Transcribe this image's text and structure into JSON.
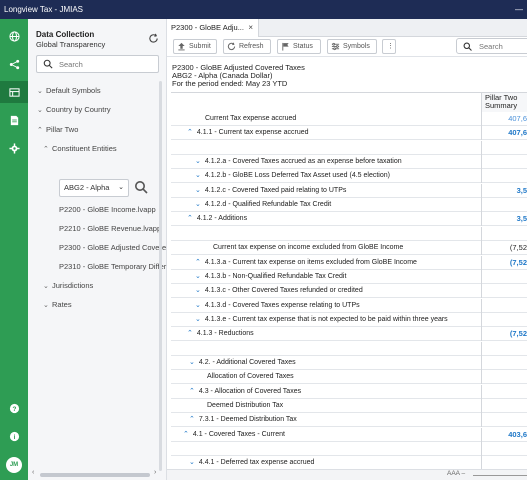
{
  "window": {
    "title": "Longview Tax - JMIAS",
    "minimize": "—"
  },
  "rail": {
    "avatar": "JM"
  },
  "panel": {
    "title": "Data Collection",
    "subtitle": "Global Transparency",
    "search_placeholder": "Search",
    "tree": [
      {
        "label": "Default Symbols",
        "chev": "⌄"
      },
      {
        "label": "Country by Country",
        "chev": "⌄"
      },
      {
        "label": "Pillar Two",
        "chev": "⌃"
      },
      {
        "label": "Constituent Entities",
        "chev": "⌃"
      },
      {
        "label": "P2200 - GloBE Income.lvapp",
        "chev": ""
      },
      {
        "label": "P2210 - GloBE Revenue.lvapp",
        "chev": ""
      },
      {
        "label": "P2300 - GloBE Adjusted Covere",
        "chev": ""
      },
      {
        "label": "P2310 - GloBE Temporary Differ",
        "chev": ""
      },
      {
        "label": "Jurisdictions",
        "chev": "⌄"
      },
      {
        "label": "Rates",
        "chev": "⌄"
      }
    ],
    "entity_select": "ABG2 - Alpha",
    "scroll_left": "‹",
    "scroll_right": "›"
  },
  "tab": {
    "label": "P2300 - GloBE Adju...",
    "close": "×"
  },
  "toolbar": {
    "submit": "Submit",
    "refresh": "Refresh",
    "status": "Status",
    "symbols": "Symbols",
    "more": "⋮",
    "search_placeholder": "Search"
  },
  "report": {
    "title": "P2300 - GloBE Adjusted Covered Taxes",
    "entity": "ABG2 - Alpha (Canada Dollar)",
    "period": "For the period ended: May 23 YTD",
    "column_header": "Pillar Two Summary"
  },
  "rows": [
    {
      "label": "Current Tax expense accrued",
      "chev": "",
      "value": "407,6",
      "style": "lblue"
    },
    {
      "label": "4.1.1 - Current tax expense accrued",
      "chev": "⌃",
      "value": "407,6",
      "style": "blue"
    },
    {
      "label": "",
      "chev": "",
      "value": "",
      "style": "dark"
    },
    {
      "label": "4.1.2.a - Covered Taxes accrued as an expense before taxation",
      "chev": "⌄",
      "value": "",
      "style": "dark"
    },
    {
      "label": "4.1.2.b - GloBE Loss Deferred Tax Asset used (4.5 election)",
      "chev": "⌄",
      "value": "",
      "style": "dark"
    },
    {
      "label": "4.1.2.c - Covered Taxed paid relating to UTPs",
      "chev": "⌄",
      "value": "3,5",
      "style": "blue"
    },
    {
      "label": "4.1.2.d - Qualified Refundable Tax Credit",
      "chev": "⌄",
      "value": "",
      "style": "dark"
    },
    {
      "label": "4.1.2 - Additions",
      "chev": "⌃",
      "value": "3,5",
      "style": "blue"
    },
    {
      "label": "",
      "chev": "",
      "value": "",
      "style": "dark"
    },
    {
      "label": "Current tax expense on income excluded from GloBE Income",
      "chev": "",
      "value": "(7,52",
      "style": "dark"
    },
    {
      "label": "4.1.3.a - Current tax expense on items excluded from GloBE Income",
      "chev": "⌃",
      "value": "(7,52",
      "style": "blue"
    },
    {
      "label": "4.1.3.b - Non-Qualified Refundable Tax Credit",
      "chev": "⌄",
      "value": "",
      "style": "dark"
    },
    {
      "label": "4.1.3.c - Other Covered Taxes refunded or credited",
      "chev": "⌄",
      "value": "",
      "style": "dark"
    },
    {
      "label": "4.1.3.d - Covered Taxes expense relating to UTPs",
      "chev": "⌄",
      "value": "",
      "style": "dark"
    },
    {
      "label": "4.1.3.e - Current tax expense that is not expected to be paid within three years",
      "chev": "⌄",
      "value": "",
      "style": "dark"
    },
    {
      "label": "4.1.3 - Reductions",
      "chev": "⌃",
      "value": "(7,52",
      "style": "blue"
    },
    {
      "label": "",
      "chev": "",
      "value": "",
      "style": "dark"
    },
    {
      "label": "4.2. - Additional Covered Taxes",
      "chev": "⌄",
      "value": "",
      "style": "dark"
    },
    {
      "label": "Allocation of Covered Taxes",
      "chev": "",
      "value": "",
      "style": "dark"
    },
    {
      "label": "4.3 - Allocation of Covered Taxes",
      "chev": "⌃",
      "value": "",
      "style": "dark"
    },
    {
      "label": "Deemed Distribution Tax",
      "chev": "",
      "value": "",
      "style": "dark"
    },
    {
      "label": "7.3.1 - Deemed Distribution Tax",
      "chev": "⌃",
      "value": "",
      "style": "dark"
    },
    {
      "label": "4.1 - Covered Taxes - Current",
      "chev": "⌃",
      "value": "403,6",
      "style": "blue"
    },
    {
      "label": "",
      "chev": "",
      "value": "",
      "style": "dark"
    },
    {
      "label": "4.4.1 - Deferred tax expense accrued",
      "chev": "⌄",
      "value": "",
      "style": "dark"
    }
  ],
  "status": {
    "zoom": "AAA –"
  }
}
